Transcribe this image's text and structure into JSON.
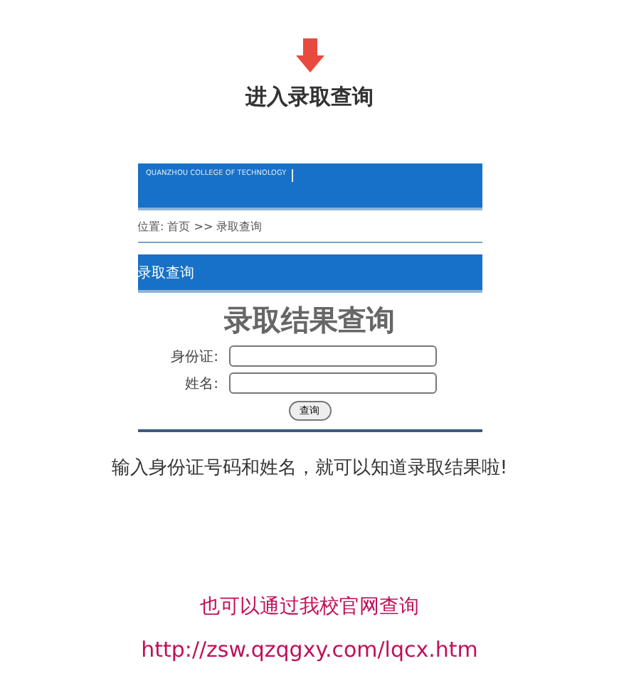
{
  "heading": "进入录取查询",
  "screenshot": {
    "college_name": "QUANZHOU COLLEGE OF TECHNOLOGY",
    "breadcrumb": "位置: 首页 >> 录取查询",
    "section_title": "录取查询",
    "form_title": "录取结果查询",
    "fields": [
      {
        "label": "身份证:"
      },
      {
        "label": "姓名:"
      }
    ],
    "submit": "查询"
  },
  "caption": "输入身份证号码和姓名，就可以知道录取结果啦!",
  "note": "也可以通过我校官网查询",
  "link": "http://zsw.qzqgxy.com/lqcx.htm"
}
